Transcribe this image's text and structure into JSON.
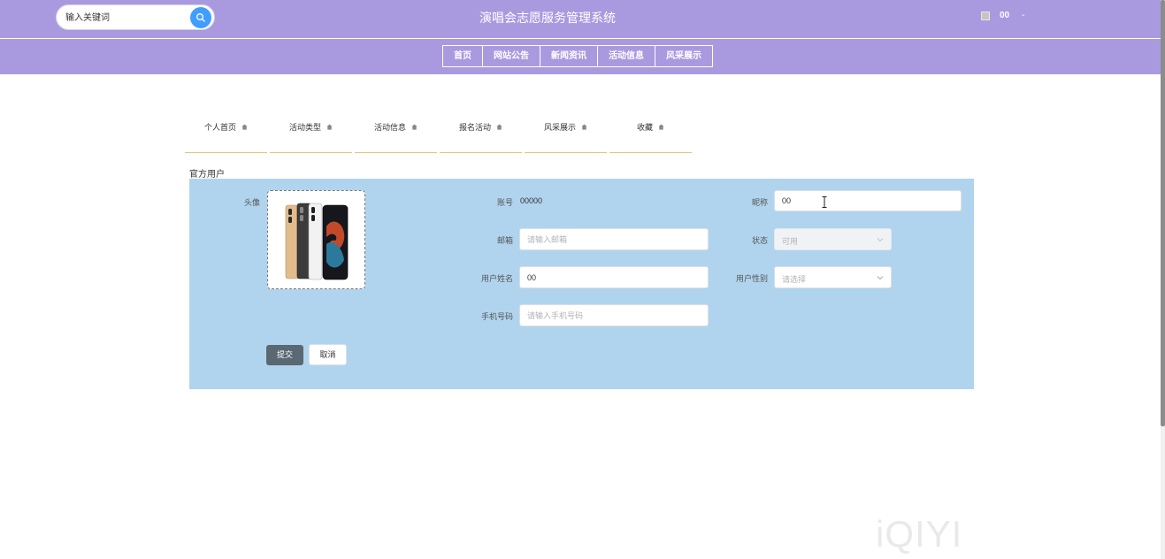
{
  "header": {
    "search_placeholder": "输入关键词",
    "title": "演唱会志愿服务管理系统",
    "user_name": "00",
    "user_dash": "-"
  },
  "nav": [
    "首页",
    "网站公告",
    "新闻资讯",
    "活动信息",
    "风采展示"
  ],
  "subtabs": [
    "个人首页",
    "活动类型",
    "活动信息",
    "报名活动",
    "风采展示",
    "收藏"
  ],
  "panel_title": "官方用户",
  "form": {
    "avatar_label": "头像",
    "account_label": "账号",
    "account_value": "00000",
    "nickname_label": "昵称",
    "nickname_value": "00",
    "email_label": "邮箱",
    "email_placeholder": "请输入邮箱",
    "status_label": "状态",
    "status_value": "可用",
    "realname_label": "用户姓名",
    "realname_value": "00",
    "gender_label": "用户性别",
    "gender_placeholder": "请选择",
    "phone_label": "手机号码",
    "phone_placeholder": "请输入手机号码",
    "submit": "提交",
    "cancel": "取消"
  },
  "watermark": "iQIYI",
  "colors": {
    "header": "#a99ae0",
    "panel": "#b0d4ee",
    "search_button": "#409eff",
    "submit_button": "#5a6874",
    "tab_underline": "#e8c37a"
  }
}
